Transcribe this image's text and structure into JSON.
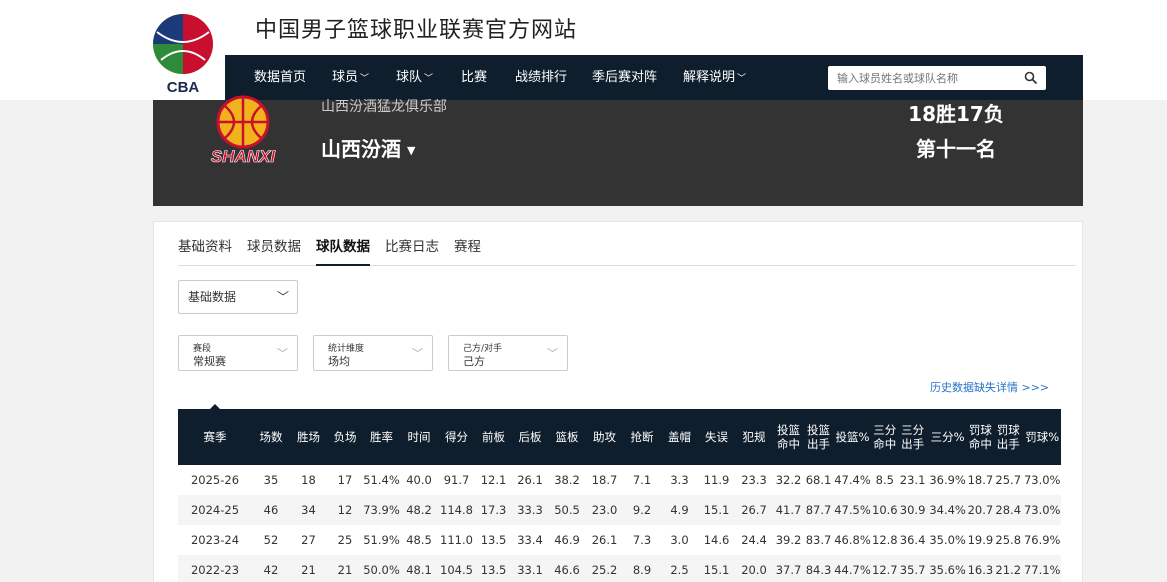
{
  "site": {
    "title": "中国男子篮球职业联赛官方网站",
    "logo_text": "CBA"
  },
  "nav": {
    "items": [
      {
        "label": "数据首页",
        "caret": false
      },
      {
        "label": "球员",
        "caret": true
      },
      {
        "label": "球队",
        "caret": true
      },
      {
        "label": "比赛",
        "caret": false
      },
      {
        "label": "战绩排行",
        "caret": false
      },
      {
        "label": "季后赛对阵",
        "caret": false
      },
      {
        "label": "解释说明",
        "caret": true
      }
    ],
    "search_placeholder": "输入球员姓名或球队名称"
  },
  "team": {
    "club_name": "山西汾酒猛龙俱乐部",
    "name": "山西汾酒",
    "record": "18胜17负",
    "rank": "第十一名",
    "logo_text": "SHANXI"
  },
  "tabs": [
    "基础资料",
    "球员数据",
    "球队数据",
    "比赛日志",
    "赛程"
  ],
  "active_tab": "球队数据",
  "stat_type": "基础数据",
  "filters": [
    {
      "label": "赛段",
      "value": "常规赛"
    },
    {
      "label": "统计维度",
      "value": "场均"
    },
    {
      "label": "己方/对手",
      "value": "己方"
    }
  ],
  "history_link": "历史数据缺失详情 >>>",
  "table": {
    "headers": [
      "赛季",
      "场数",
      "胜场",
      "负场",
      "胜率",
      "时间",
      "得分",
      "前板",
      "后板",
      "篮板",
      "助攻",
      "抢断",
      "盖帽",
      "失误",
      "犯规",
      "投篮命中",
      "投篮出手",
      "投篮%",
      "三分命中",
      "三分出手",
      "三分%",
      "罚球命中",
      "罚球出手",
      "罚球%"
    ],
    "rows": [
      [
        "2025-26",
        "35",
        "18",
        "17",
        "51.4%",
        "40.0",
        "91.7",
        "12.1",
        "26.1",
        "38.2",
        "18.7",
        "7.1",
        "3.3",
        "11.9",
        "23.3",
        "32.2",
        "68.1",
        "47.4%",
        "8.5",
        "23.1",
        "36.9%",
        "18.7",
        "25.7",
        "73.0%"
      ],
      [
        "2024-25",
        "46",
        "34",
        "12",
        "73.9%",
        "48.2",
        "114.8",
        "17.3",
        "33.3",
        "50.5",
        "23.0",
        "9.2",
        "4.9",
        "15.1",
        "26.7",
        "41.7",
        "87.7",
        "47.5%",
        "10.6",
        "30.9",
        "34.4%",
        "20.7",
        "28.4",
        "73.0%"
      ],
      [
        "2023-24",
        "52",
        "27",
        "25",
        "51.9%",
        "48.5",
        "111.0",
        "13.5",
        "33.4",
        "46.9",
        "26.1",
        "7.3",
        "3.0",
        "14.6",
        "24.4",
        "39.2",
        "83.7",
        "46.8%",
        "12.8",
        "36.4",
        "35.0%",
        "19.9",
        "25.8",
        "76.9%"
      ],
      [
        "2022-23",
        "42",
        "21",
        "21",
        "50.0%",
        "48.1",
        "104.5",
        "13.5",
        "33.1",
        "46.6",
        "25.2",
        "8.9",
        "2.5",
        "15.1",
        "20.0",
        "37.7",
        "84.3",
        "44.7%",
        "12.7",
        "35.7",
        "35.6%",
        "16.3",
        "21.2",
        "77.1%"
      ]
    ]
  }
}
